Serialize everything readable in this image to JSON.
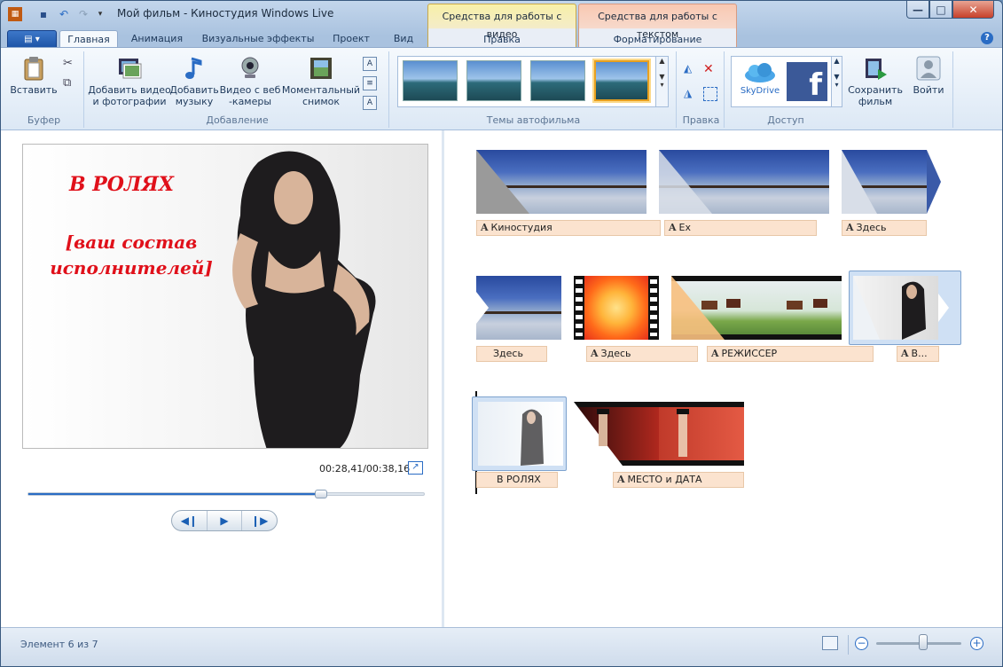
{
  "window": {
    "title": "Мой фильм - Киностудия Windows Live"
  },
  "context_tabs": [
    {
      "title": "Средства для работы с видео",
      "sub": "Правка",
      "color": "#f7f0a8"
    },
    {
      "title": "Средства для работы с текстом",
      "sub": "Форматирование",
      "color": "#f8c8b2"
    }
  ],
  "tabs": [
    "Главная",
    "Анимация",
    "Визуальные эффекты",
    "Проект",
    "Вид"
  ],
  "ribbon": {
    "paste": "Вставить",
    "group_clipboard": "Буфер",
    "add_video": "Добавить видео и фотографии",
    "add_music": "Добавить музыку",
    "webcam": "Видео с веб -камеры",
    "snapshot": "Моментальный снимок",
    "group_add": "Добавление",
    "group_themes": "Темы автофильма",
    "group_edit": "Правка",
    "skydrive": "SkyDrive",
    "group_share": "Доступ",
    "save_movie": "Сохранить фильм",
    "signin": "Войти"
  },
  "preview": {
    "title": "В РОЛЯХ",
    "subtitle": "[ваш состав исполнителей]",
    "time": "00:28,41/00:38,16",
    "progress": 0.74
  },
  "storyboard": {
    "captions": [
      "Киностудия",
      "Ex",
      "Здесь",
      "Здесь",
      "Здесь",
      "РЕЖИССЕР",
      "В...",
      "В РОЛЯХ",
      "МЕСТО и ДАТА"
    ]
  },
  "status": {
    "text": "Элемент 6 из 7",
    "zoom": 0.55
  },
  "colors": {
    "accent": "#2a6cc4",
    "caption_bg": "#fbe3cf",
    "title_red": "#e0101a"
  }
}
